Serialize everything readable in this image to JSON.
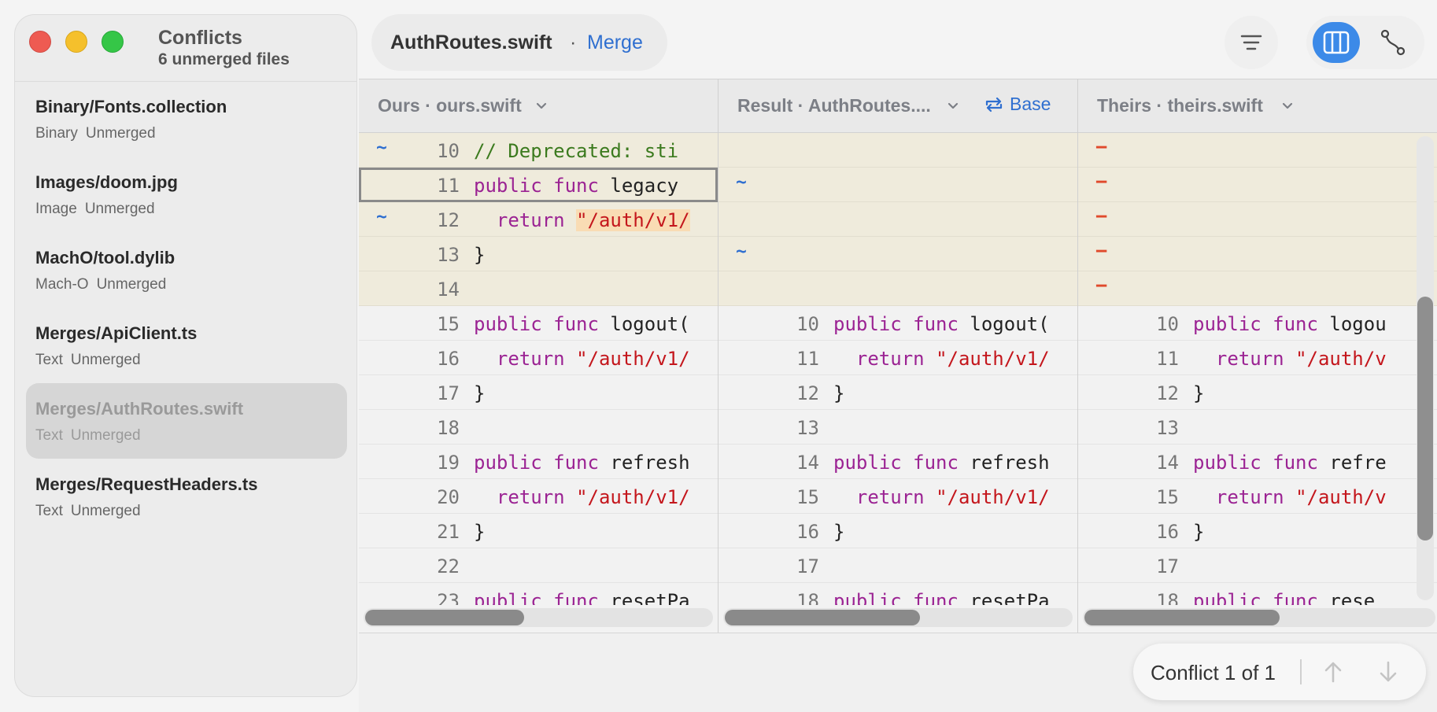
{
  "sidebar": {
    "title": "Conflicts",
    "subtitle": "6 unmerged files",
    "files": [
      {
        "name": "Binary/Fonts.collection",
        "kind": "Binary",
        "status": "Unmerged"
      },
      {
        "name": "Images/doom.jpg",
        "kind": "Image",
        "status": "Unmerged"
      },
      {
        "name": "MachO/tool.dylib",
        "kind": "Mach-O",
        "status": "Unmerged"
      },
      {
        "name": "Merges/ApiClient.ts",
        "kind": "Text",
        "status": "Unmerged"
      },
      {
        "name": "Merges/AuthRoutes.swift",
        "kind": "Text",
        "status": "Unmerged",
        "selected": true
      },
      {
        "name": "Merges/RequestHeaders.ts",
        "kind": "Text",
        "status": "Unmerged"
      }
    ]
  },
  "header": {
    "file": "AuthRoutes.swift",
    "separator": "·",
    "mode": "Merge"
  },
  "panes": {
    "ours": {
      "title": "Ours · ours.swift"
    },
    "result": {
      "title": "Result · AuthRoutes....",
      "base_label": "Base"
    },
    "theirs": {
      "title": "Theirs · theirs.swift"
    }
  },
  "ours_lines": [
    {
      "marker": "~",
      "num": "10",
      "text": "// Deprecated: sti"
    },
    {
      "marker": "",
      "num": "11",
      "text": "public func legacy"
    },
    {
      "marker": "~",
      "num": "12",
      "text": "  return \"/auth/v1/"
    },
    {
      "marker": "",
      "num": "13",
      "text": "}"
    },
    {
      "marker": "",
      "num": "14",
      "text": ""
    },
    {
      "marker": "",
      "num": "15",
      "text": "public func logout("
    },
    {
      "marker": "",
      "num": "16",
      "text": "  return \"/auth/v1/"
    },
    {
      "marker": "",
      "num": "17",
      "text": "}"
    },
    {
      "marker": "",
      "num": "18",
      "text": ""
    },
    {
      "marker": "",
      "num": "19",
      "text": "public func refresh"
    },
    {
      "marker": "",
      "num": "20",
      "text": "  return \"/auth/v1/"
    },
    {
      "marker": "",
      "num": "21",
      "text": "}"
    },
    {
      "marker": "",
      "num": "22",
      "text": ""
    },
    {
      "marker": "",
      "num": "23",
      "text": "public func resetPa"
    }
  ],
  "result_lines": [
    {
      "marker": "",
      "num": "",
      "text": ""
    },
    {
      "marker": "~",
      "num": "",
      "text": ""
    },
    {
      "marker": "",
      "num": "",
      "text": ""
    },
    {
      "marker": "~",
      "num": "",
      "text": ""
    },
    {
      "marker": "",
      "num": "",
      "text": ""
    },
    {
      "marker": "",
      "num": "10",
      "text": "public func logout("
    },
    {
      "marker": "",
      "num": "11",
      "text": "  return \"/auth/v1/"
    },
    {
      "marker": "",
      "num": "12",
      "text": "}"
    },
    {
      "marker": "",
      "num": "13",
      "text": ""
    },
    {
      "marker": "",
      "num": "14",
      "text": "public func refresh"
    },
    {
      "marker": "",
      "num": "15",
      "text": "  return \"/auth/v1/"
    },
    {
      "marker": "",
      "num": "16",
      "text": "}"
    },
    {
      "marker": "",
      "num": "17",
      "text": ""
    },
    {
      "marker": "",
      "num": "18",
      "text": "public func resetPa"
    }
  ],
  "theirs_lines": [
    {
      "marker": "−",
      "num": "",
      "text": ""
    },
    {
      "marker": "−",
      "num": "",
      "text": ""
    },
    {
      "marker": "−",
      "num": "",
      "text": ""
    },
    {
      "marker": "−",
      "num": "",
      "text": ""
    },
    {
      "marker": "−",
      "num": "",
      "text": ""
    },
    {
      "marker": "",
      "num": "10",
      "text": "public func logou"
    },
    {
      "marker": "",
      "num": "11",
      "text": "  return \"/auth/v"
    },
    {
      "marker": "",
      "num": "12",
      "text": "}"
    },
    {
      "marker": "",
      "num": "13",
      "text": ""
    },
    {
      "marker": "",
      "num": "14",
      "text": "public func refre"
    },
    {
      "marker": "",
      "num": "15",
      "text": "  return \"/auth/v"
    },
    {
      "marker": "",
      "num": "16",
      "text": "}"
    },
    {
      "marker": "",
      "num": "17",
      "text": ""
    },
    {
      "marker": "",
      "num": "18",
      "text": "public func rese"
    }
  ],
  "conflict": {
    "label": "Conflict 1 of 1"
  },
  "colors": {
    "accent": "#2f6fd0",
    "conflict_bg": "#efebdc",
    "minus": "#e04a2c",
    "keyword": "#9b2393",
    "string": "#c4161c",
    "comment": "#3b7a1e"
  },
  "icons": {
    "filter": "filter-lines-icon",
    "columns": "three-columns-icon",
    "graph": "branch-graph-icon",
    "swap": "swap-arrows-icon",
    "up": "arrow-up-icon",
    "down": "arrow-down-icon"
  }
}
